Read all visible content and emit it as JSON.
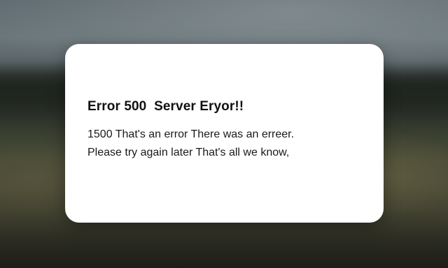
{
  "error": {
    "title": "Error 500  Server Eryor!!",
    "message_lines": [
      "1500 That's an error There was an erreer.",
      "Please try again later That's all we know,"
    ]
  },
  "colors": {
    "card_background": "#ffffff",
    "title_text": "#111111",
    "body_text": "#1a1a1a"
  }
}
